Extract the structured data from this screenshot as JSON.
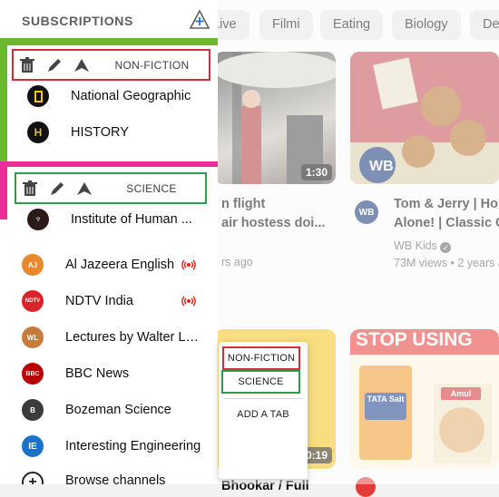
{
  "chips": [
    {
      "label": "Live"
    },
    {
      "label": "Filmi"
    },
    {
      "label": "Eating"
    },
    {
      "label": "Biology"
    },
    {
      "label": "De"
    }
  ],
  "videos": [
    {
      "duration": "1:30",
      "title_line1": "n flight",
      "title_line2": "air hostess doi...",
      "meta": "rs ago"
    },
    {
      "title_line1": "Tom & Jerry | Hom",
      "title_line2": "Alone! | Classic Ca",
      "channel": "WB Kids",
      "meta": "73M views • 2 years a"
    },
    {
      "duration": "0:19",
      "title_partial": "Bhookar / Full"
    },
    {
      "banner": "STOP USING",
      "brand1": "TATA Salt",
      "brand2": "Amul"
    }
  ],
  "sidebar": {
    "header": "SUBSCRIPTIONS",
    "tabs": [
      {
        "label": "NON-FICTION",
        "channels": [
          "National Geographic",
          "HISTORY"
        ]
      },
      {
        "label": "SCIENCE",
        "channels": [
          "Institute of Human ..."
        ]
      }
    ],
    "channels": [
      {
        "name": "Al Jazeera English",
        "live": true,
        "avatar_text": "AJ",
        "color": "#e7892c"
      },
      {
        "name": "NDTV India",
        "live": true,
        "avatar_text": "NDTV",
        "color": "#d8242a"
      },
      {
        "name": "Lectures by Walter Le...",
        "live": false,
        "avatar_text": "WL",
        "color": "#c87a3a"
      },
      {
        "name": "BBC News",
        "live": false,
        "avatar_text": "BBC",
        "color": "#b80000"
      },
      {
        "name": "Bozeman Science",
        "live": false,
        "avatar_text": "B",
        "color": "#3b3b3b"
      },
      {
        "name": "Interesting Engineering",
        "live": false,
        "avatar_text": "IE",
        "color": "#1a73c9"
      },
      {
        "name": "Browse channels",
        "live": false
      }
    ]
  },
  "popup": {
    "items": [
      "NON-FICTION",
      "SCIENCE"
    ],
    "add_tab": "ADD A TAB"
  },
  "colors": {
    "nonfiction_accent": "#d32f3a",
    "science_accent": "#2f9e4a",
    "group_green": "#6ab82e",
    "group_pink": "#ee2d9c",
    "live_red": "#e62117"
  }
}
